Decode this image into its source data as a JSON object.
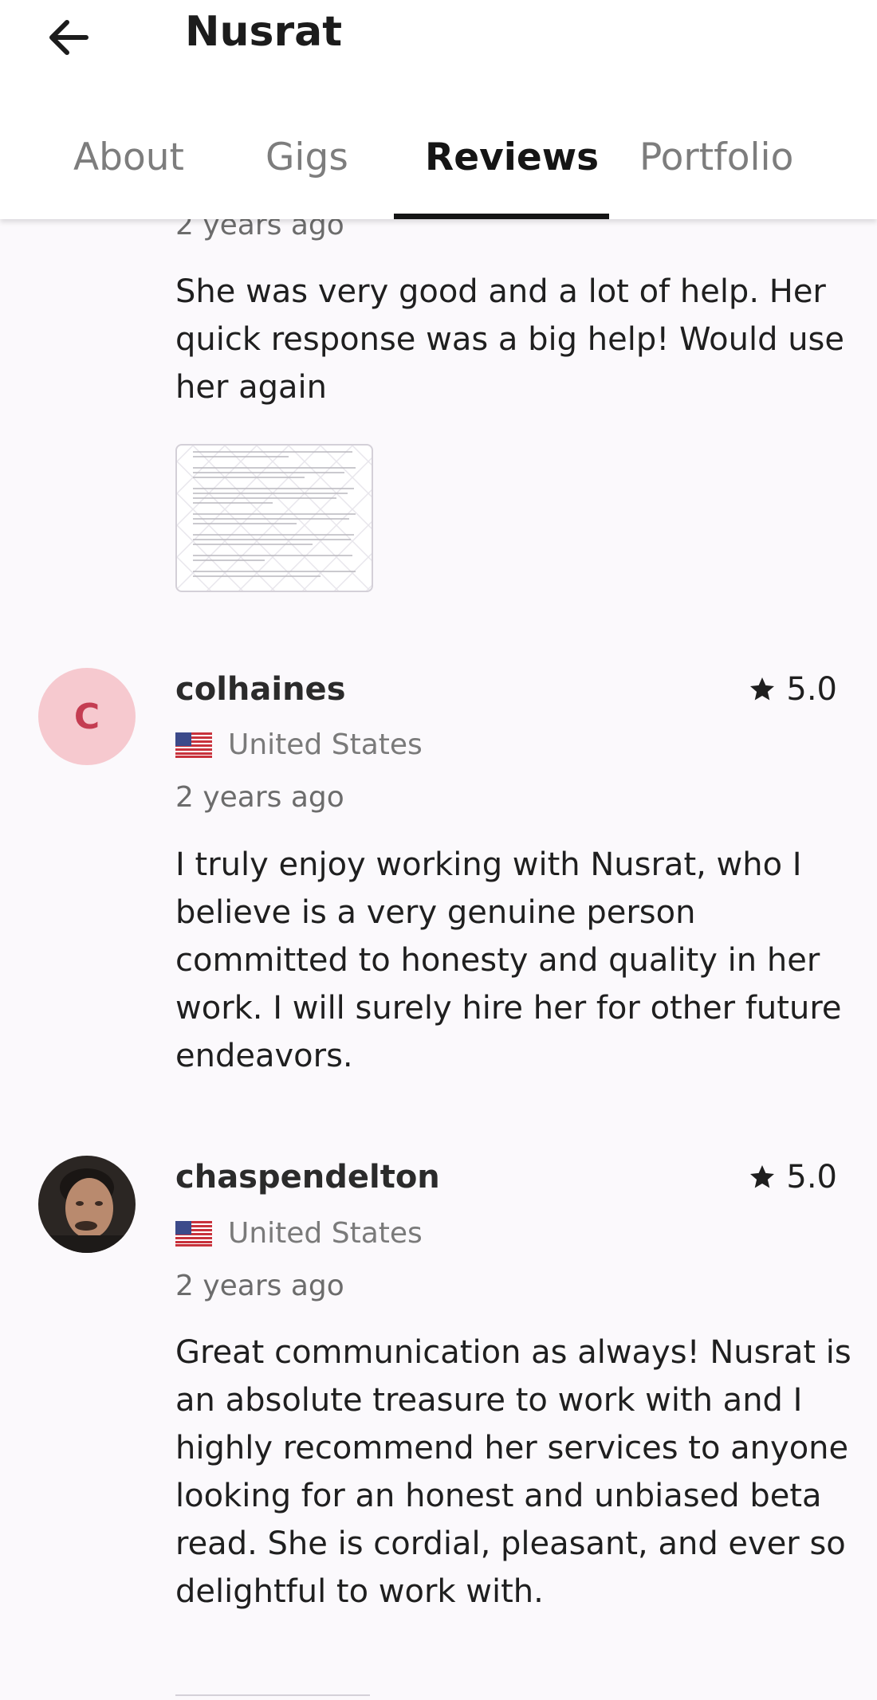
{
  "header": {
    "title": "Nusrat",
    "tabs": [
      {
        "label": "About"
      },
      {
        "label": "Gigs"
      },
      {
        "label": "Reviews"
      },
      {
        "label": "Portfolio"
      }
    ],
    "active_tab": "Reviews"
  },
  "reviews": [
    {
      "timestamp": "2 years ago",
      "text": "She was very good and a lot of help.  Her quick response was a big help! Would use her again",
      "has_attachment": true
    },
    {
      "avatar_letter": "C",
      "username": "colhaines",
      "rating": "5.0",
      "country": "United States",
      "timestamp": "2 years ago",
      "text": "I truly enjoy working with Nusrat, who I believe is a very genuine person committed to honesty and quality in her work. I will surely hire her for other future endeavors."
    },
    {
      "username": "chaspendelton",
      "rating": "5.0",
      "country": "United States",
      "timestamp": "2 years ago",
      "text": "Great communication as always! Nusrat is an absolute treasure to work with and I highly recommend her services to anyone looking for an honest and unbiased beta read. She is cordial, pleasant, and ever so delightful to work with."
    }
  ],
  "colors": {
    "background": "#fbf9fc",
    "avatar_bg": "#f6c9cf",
    "avatar_letter": "#c43d52",
    "active_tab": "#151515",
    "inactive_tab": "#7d7d7d"
  }
}
